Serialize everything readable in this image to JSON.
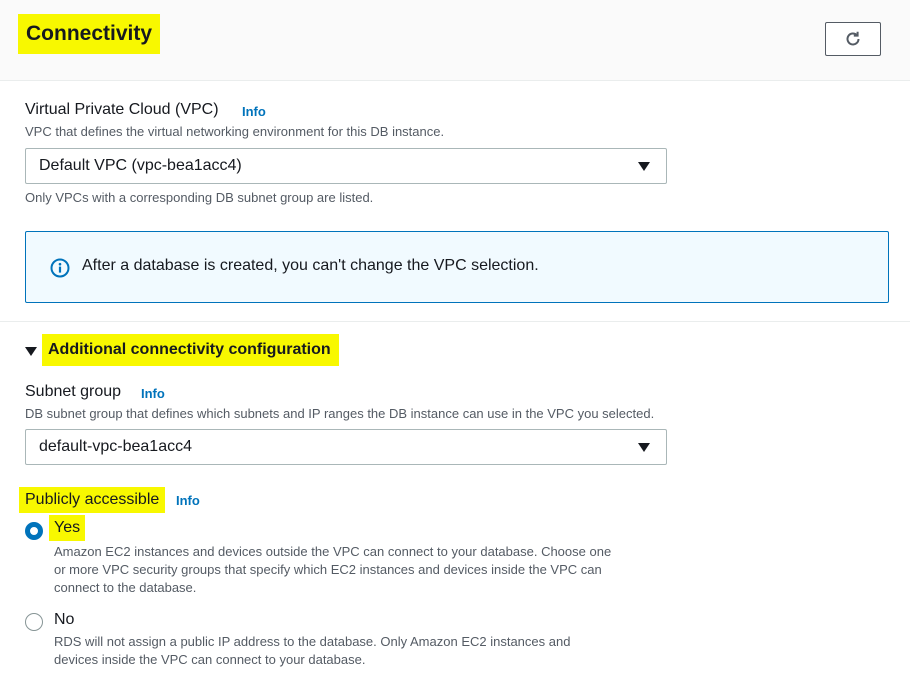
{
  "header": {
    "title": "Connectivity",
    "refresh_icon": "refresh-icon"
  },
  "vpc": {
    "label": "Virtual Private Cloud (VPC)",
    "info": "Info",
    "description": "VPC that defines the virtual networking environment for this DB instance.",
    "selected": "Default VPC (vpc-bea1acc4)",
    "hint": "Only VPCs with a corresponding DB subnet group are listed."
  },
  "alert": {
    "icon": "info-circle-icon",
    "text": "After a database is created, you can't change the VPC selection."
  },
  "additional": {
    "label": "Additional connectivity configuration",
    "expanded": true
  },
  "subnet": {
    "label": "Subnet group",
    "info": "Info",
    "description": "DB subnet group that defines which subnets and IP ranges the DB instance can use in the VPC you selected.",
    "selected": "default-vpc-bea1acc4"
  },
  "public_access": {
    "label": "Publicly accessible",
    "info": "Info",
    "options": [
      {
        "label": "Yes",
        "selected": true,
        "description_lines": [
          "Amazon EC2 instances and devices outside the VPC can connect to your database. Choose one",
          "or more VPC security groups that specify which EC2 instances and devices inside the VPC can",
          "connect to the database."
        ]
      },
      {
        "label": "No",
        "selected": false,
        "description_lines": [
          "RDS will not assign a public IP address to the database. Only Amazon EC2 instances and",
          "devices inside the VPC can connect to your database."
        ]
      }
    ]
  },
  "colors": {
    "accent": "#0073bb",
    "highlight": "#f8f800",
    "alert_bg": "#f1faff"
  }
}
